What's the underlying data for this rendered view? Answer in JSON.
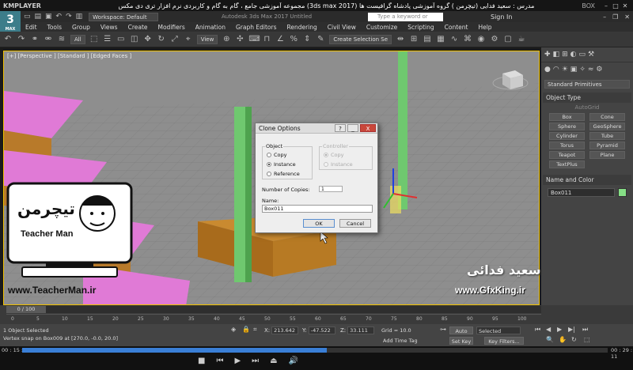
{
  "player": {
    "name": "KMPLAYER",
    "course_title": "مجموعه آموزشی جامع ، گام به گام و کاربردی نرم افزار تری دی مکس (3ds max 2017)  مدرس : سعید فدایی (تیچرمن ) گروه آموزشی پادشاه گرافیست ها",
    "box_label": "BOX",
    "time_elapsed": "00 : 15 : 06",
    "time_total": "00 : 29 : 11",
    "progress": 0.52
  },
  "app": {
    "logo_label": "3",
    "logo_sub": "MAX",
    "workspace": "Workspace: Default",
    "title": "Autodesk 3ds Max 2017    Untitled",
    "search_placeholder": "Type a keyword or phrase",
    "sign_in": "Sign In"
  },
  "menu": [
    "Edit",
    "Tools",
    "Group",
    "Views",
    "Create",
    "Modifiers",
    "Animation",
    "Graph Editors",
    "Rendering",
    "Civil View",
    "Customize",
    "Scripting",
    "Content",
    "Help"
  ],
  "toolbar": {
    "filter": "All",
    "refcoord": "View",
    "selection_set": "Create Selection Se"
  },
  "viewport": {
    "label": "[+] [Perspective ] [Standard ] [Edged Faces ]"
  },
  "command_panel": {
    "category": "Standard Primitives",
    "object_type_header": "Object Type",
    "autogrid": "AutoGrid",
    "primitives": [
      "Box",
      "Cone",
      "Sphere",
      "GeoSphere",
      "Cylinder",
      "Tube",
      "Torus",
      "Pyramid",
      "Teapot",
      "Plane",
      "TextPlus"
    ],
    "name_color_header": "Name and Color",
    "object_name": "Box011",
    "object_color": "#86df86"
  },
  "dialog": {
    "title": "Clone Options",
    "object_group": "Object",
    "object_options": [
      "Copy",
      "Instance",
      "Reference"
    ],
    "selected_object_option": "Instance",
    "controller_group": "Controller",
    "controller_options": [
      "Copy",
      "Instance"
    ],
    "copies_label": "Number of Copies:",
    "copies_value": "1",
    "name_label": "Name:",
    "name_value": "Box011",
    "ok": "OK",
    "cancel": "Cancel",
    "help": "?",
    "minimize": "_",
    "close": "X"
  },
  "timeline": {
    "frame_display": "0 / 100",
    "ticks": [
      "0",
      "5",
      "10",
      "15",
      "20",
      "25",
      "30",
      "35",
      "40",
      "45",
      "50",
      "55",
      "60",
      "65",
      "70",
      "75",
      "80",
      "85",
      "90",
      "95",
      "100"
    ]
  },
  "status": {
    "selection": "1 Object Selected",
    "prompt": "Vertex snap on Box009 at [270.0, -0.0, 20.0]",
    "x_label": "X:",
    "x_value": "213.642",
    "y_label": "Y:",
    "y_value": "-47.522",
    "z_label": "Z:",
    "z_value": "33.111",
    "grid": "Grid = 10.0",
    "add_time_tag": "Add Time Tag",
    "auto_key": "Auto Key",
    "set_key": "Set Key",
    "selected_dd": "Selected",
    "key_filters": "Key Filters..."
  },
  "overlays": {
    "brand_name": "Teacher Man",
    "brand_persian": "تیچرمن",
    "website_left": "www.TeacherMan.ir",
    "website_right": "www.GfxKing.ir",
    "persian_name": "سعید فدائی"
  }
}
